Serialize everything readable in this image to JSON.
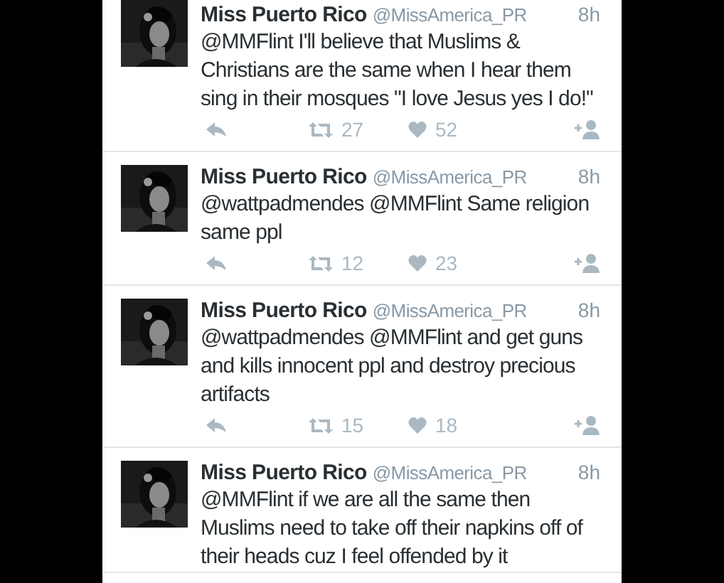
{
  "tweets": [
    {
      "name": "Miss Puerto Rico",
      "handle": "@MissAmerica_PR",
      "time": "8h",
      "text": "@MMFlint I'll believe that Muslims & Christians are the same when I hear them sing in their mosques \"I love Jesus yes I do!\"",
      "retweets": "27",
      "likes": "52"
    },
    {
      "name": "Miss Puerto Rico",
      "handle": "@MissAmerica_PR",
      "time": "8h",
      "text": "@wattpadmendes @MMFlint Same religion same ppl",
      "retweets": "12",
      "likes": "23"
    },
    {
      "name": "Miss Puerto Rico",
      "handle": "@MissAmerica_PR",
      "time": "8h",
      "text": "@wattpadmendes @MMFlint and get guns and kills innocent ppl and destroy precious artifacts",
      "retweets": "15",
      "likes": "18"
    },
    {
      "name": "Miss Puerto Rico",
      "handle": "@MissAmerica_PR",
      "time": "8h",
      "text": "@MMFlint if we are all the same then Muslims need to take off their napkins off of their heads cuz I feel offended by it"
    }
  ]
}
